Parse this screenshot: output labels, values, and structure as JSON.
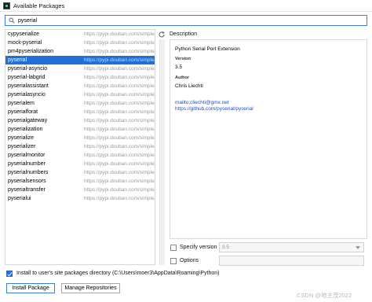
{
  "window": {
    "title": "Available Packages"
  },
  "search": {
    "value": "pyserial"
  },
  "packages": [
    {
      "name": "cypyserialize",
      "source": "https://pypi.douban.com/simple/",
      "selected": false
    },
    {
      "name": "mock-pyserial",
      "source": "https://pypi.douban.com/simple/",
      "selected": false
    },
    {
      "name": "pm4pyserialization",
      "source": "https://pypi.douban.com/simple/",
      "selected": false
    },
    {
      "name": "pyserial",
      "source": "https://pypi.douban.com/simple/",
      "selected": true
    },
    {
      "name": "pyserial-asyncio",
      "source": "https://pypi.douban.com/simple/",
      "selected": false
    },
    {
      "name": "pyserial-labgrid",
      "source": "https://pypi.douban.com/simple/",
      "selected": false
    },
    {
      "name": "pyserialassistant",
      "source": "https://pypi.douban.com/simple/",
      "selected": false
    },
    {
      "name": "pyserialasyncio",
      "source": "https://pypi.douban.com/simple/",
      "selected": false
    },
    {
      "name": "pyserialem",
      "source": "https://pypi.douban.com/simple/",
      "selected": false
    },
    {
      "name": "pyserialforat",
      "source": "https://pypi.douban.com/simple/",
      "selected": false
    },
    {
      "name": "pyserialgateway",
      "source": "https://pypi.douban.com/simple/",
      "selected": false
    },
    {
      "name": "pyserialization",
      "source": "https://pypi.douban.com/simple/",
      "selected": false
    },
    {
      "name": "pyserialize",
      "source": "https://pypi.douban.com/simple/",
      "selected": false
    },
    {
      "name": "pyserializer",
      "source": "https://pypi.douban.com/simple/",
      "selected": false
    },
    {
      "name": "pyserialmonitor",
      "source": "https://pypi.douban.com/simple/",
      "selected": false
    },
    {
      "name": "pyserialnumber",
      "source": "https://pypi.douban.com/simple/",
      "selected": false
    },
    {
      "name": "pyserialnumbers",
      "source": "https://pypi.douban.com/simple/",
      "selected": false
    },
    {
      "name": "pyserialsensors",
      "source": "https://pypi.douban.com/simple/",
      "selected": false
    },
    {
      "name": "pyserialtransfer",
      "source": "https://pypi.douban.com/simple/",
      "selected": false
    },
    {
      "name": "pyserialui",
      "source": "https://pypi.douban.com/simple/",
      "selected": false
    }
  ],
  "description": {
    "heading": "Description",
    "summary": "Python Serial Port Extension",
    "version_label": "Version",
    "version": "3.5",
    "author_label": "Author",
    "author": "Chris Liechti",
    "email": "mailto:cliechti@gmx.net",
    "homepage": "https://github.com/pyserial/pyserial"
  },
  "options": {
    "specify_version_label": "Specify version",
    "specify_version_value": "3.5",
    "options_label": "Options",
    "options_value": ""
  },
  "footer": {
    "install_to_user_label": "Install to user's site packages directory (C:\\Users\\moer3\\AppData\\Roaming\\Python)",
    "install_button": "Install Package",
    "manage_button": "Manage Repositories"
  },
  "watermark": "CSDN @地主茂2022",
  "colors": {
    "selection": "#1f6fd4",
    "link": "#1a4fd6",
    "focus_border": "#3c7fd6"
  }
}
